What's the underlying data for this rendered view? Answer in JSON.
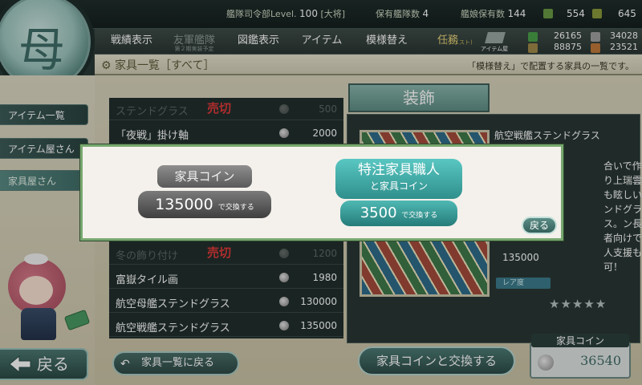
{
  "topbar": {
    "hq_label": "艦隊司令部Level.",
    "hq_level": "100",
    "rank": "[大将]",
    "ships_label": "保有艦隊数",
    "ships_value": "4",
    "ship_girls_label": "艦娘保有数",
    "ship_girls_value": "144",
    "bucket_value": "554",
    "devmat_value": "645"
  },
  "nav": {
    "items": [
      {
        "label": "戦績表示",
        "sub": ""
      },
      {
        "label": "友軍艦隊",
        "sub": "第２期実装予定"
      },
      {
        "label": "図鑑表示",
        "sub": ""
      },
      {
        "label": "アイテム",
        "sub": ""
      },
      {
        "label": "模様替え",
        "sub": ""
      },
      {
        "label": "任務",
        "sub": "(クエスト)"
      },
      {
        "label": "アイテム屋",
        "sub": ""
      }
    ]
  },
  "resources": {
    "fuel": "26165",
    "ammo": "88875",
    "steel": "34028",
    "bauxite": "23521"
  },
  "header": {
    "title": "家具一覧［すべて］",
    "note": "「模様替え」で配置する家具の一覧です。"
  },
  "sidebar": {
    "items": [
      {
        "label": "アイテム一覧"
      },
      {
        "label": "アイテム屋さん"
      },
      {
        "label": "家具屋さん"
      }
    ],
    "back_label": "戻る"
  },
  "list": {
    "sold_label": "売切",
    "rows": [
      {
        "name": "ステンドグラス",
        "price": "500",
        "sold": true
      },
      {
        "name": "「夜戦」掛け軸",
        "price": "2000",
        "sold": false
      },
      {
        "name": "冬の飾り付け",
        "price": "1200",
        "sold": true
      },
      {
        "name": "富嶽タイル画",
        "price": "1980",
        "sold": false
      },
      {
        "name": "航空母艦ステンドグラス",
        "price": "130000",
        "sold": false
      },
      {
        "name": "航空戦艦ステンドグラス",
        "price": "135000",
        "sold": false
      }
    ],
    "back_to_list": "家具一覧に戻る"
  },
  "detail": {
    "category": "装飾",
    "name": "航空戦艦ステンドグラス",
    "description": "合いで作り上瑞雲も眩しいンドグラス。ン長者向けで人支援も可！",
    "price": "135000",
    "rarity_label": "レア度",
    "stars": "★★★★★"
  },
  "footer": {
    "exchange_label": "家具コインと交換する",
    "coin_label": "家具コイン",
    "coin_value": "36540"
  },
  "modal": {
    "coin_option_title": "家具コイン",
    "coin_option_amount": "135000",
    "coin_option_suffix": "で交換する",
    "craft_option_line1": "特注家具職人",
    "craft_option_line2": "と家具コイン",
    "craft_option_amount": "3500",
    "craft_option_suffix": "で交換する",
    "back_label": "戻る"
  },
  "colors": {
    "sold_red": "#e03a3a",
    "accent_teal": "#3f9e99",
    "modal_border": "#78a870"
  }
}
